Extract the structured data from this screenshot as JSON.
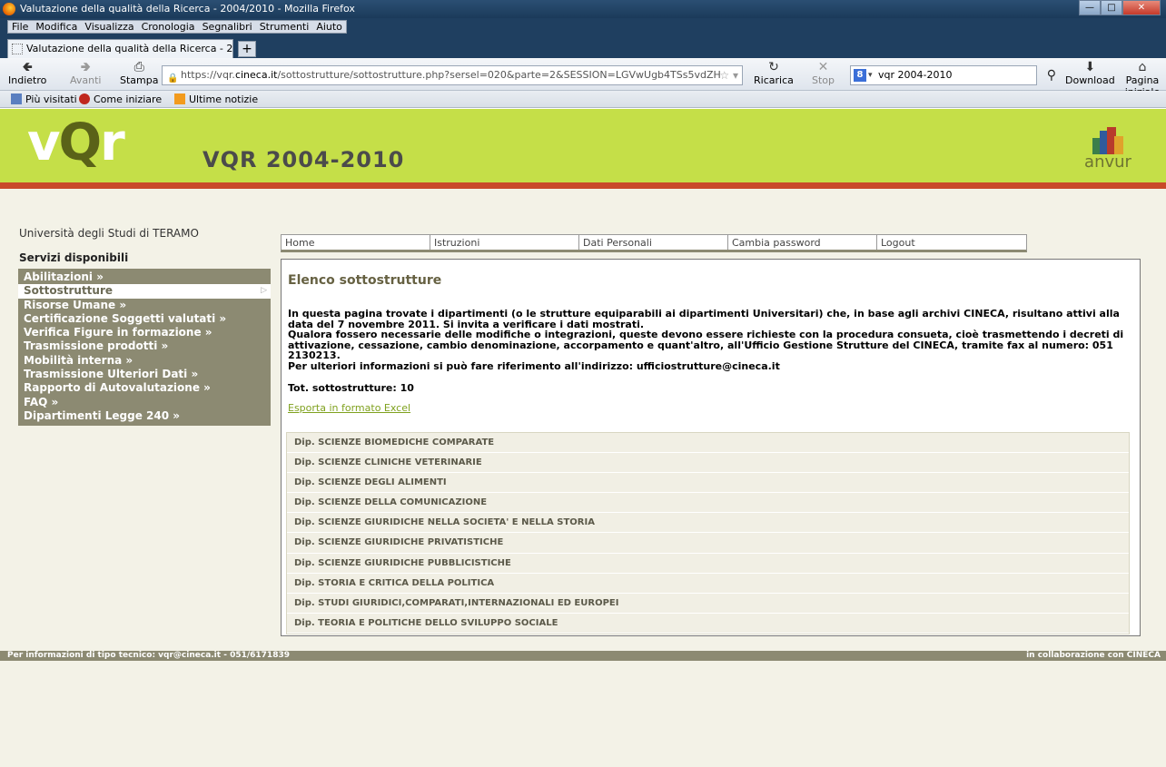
{
  "browser": {
    "window_title": "Valutazione della qualità della Ricerca - 2004/2010 - Mozilla Firefox",
    "menu": [
      "File",
      "Modifica",
      "Visualizza",
      "Cronologia",
      "Segnalibri",
      "Strumenti",
      "Aiuto"
    ],
    "tab_title": "Valutazione della qualità della Ricerca - 2...",
    "new_tab": "+",
    "nav": {
      "back": "Indietro",
      "forward": "Avanti",
      "print": "Stampa",
      "reload": "Ricarica",
      "stop": "Stop",
      "download": "Download",
      "home": "Pagina iniziale"
    },
    "url_prefix": "https://vqr.",
    "url_domain": "cineca.it",
    "url_suffix": "/sottostrutture/sottostrutture.php?sersel=020&parte=2&SESSION=LGVwUgb4TSs5vdZH",
    "search_value": "vqr 2004-2010",
    "bookmarks": [
      "Più visitati",
      "Come iniziare",
      "Ultime notizie"
    ]
  },
  "header": {
    "logo_left": "v",
    "logo_q": "Q",
    "logo_right": "r",
    "title": "VQR 2004-2010",
    "partner_logo": "anvur"
  },
  "sidebar": {
    "university": "Università degli Studi di TERAMO",
    "services_title": "Servizi disponibili",
    "items": [
      {
        "label": "Abilitazioni »"
      },
      {
        "label": "Sottostrutture"
      },
      {
        "label": "Risorse Umane »"
      },
      {
        "label": "Certificazione Soggetti valutati »"
      },
      {
        "label": "Verifica Figure in formazione »"
      },
      {
        "label": "Trasmissione prodotti »"
      },
      {
        "label": "Mobilità interna »"
      },
      {
        "label": "Trasmissione Ulteriori Dati »"
      },
      {
        "label": "Rapporto di Autovalutazione »"
      },
      {
        "label": "FAQ »"
      },
      {
        "label": "Dipartimenti Legge 240 »"
      }
    ],
    "active_index": 1
  },
  "topnav": [
    "Home",
    "Istruzioni",
    "Dati Personali",
    "Cambia password",
    "Logout"
  ],
  "main": {
    "title": "Elenco sottostrutture",
    "paragraph_1": "In questa pagina trovate i dipartimenti (o le strutture equiparabili ai dipartimenti Universitari) che, in base agli archivi CINECA, risultano attivi alla data del 7 novembre 2011. Si invita a verificare i dati mostrati.",
    "paragraph_2": "Qualora fossero necessarie delle modifiche o integrazioni, queste devono essere richieste con la procedura consueta, cioè trasmettendo i decreti di attivazione, cessazione, cambio denominazione, accorpamento e quant'altro, all'Ufficio Gestione Strutture del CINECA, tramite fax al numero: 051 2130213.",
    "paragraph_3": "Per ulteriori informazioni si può fare riferimento all'indirizzo: ufficiostrutture@cineca.it",
    "total": "Tot. sottostrutture: 10",
    "export_link": "Esporta in formato Excel",
    "departments": [
      "Dip. SCIENZE BIOMEDICHE COMPARATE",
      "Dip. SCIENZE CLINICHE VETERINARIE",
      "Dip. SCIENZE DEGLI ALIMENTI",
      "Dip. SCIENZE DELLA COMUNICAZIONE",
      "Dip. SCIENZE GIURIDICHE NELLA SOCIETA' E NELLA STORIA",
      "Dip. SCIENZE GIURIDICHE PRIVATISTICHE",
      "Dip. SCIENZE GIURIDICHE PUBBLICISTICHE",
      "Dip. STORIA E CRITICA DELLA POLITICA",
      "Dip. STUDI GIURIDICI,COMPARATI,INTERNAZIONALI ED EUROPEI",
      "Dip. TEORIA E POLITICHE DELLO SVILUPPO SOCIALE"
    ]
  },
  "footer": {
    "left": "Per informazioni di tipo tecnico: vqr@cineca.it - 051/6171839",
    "right": "in collaborazione con CINECA"
  },
  "colors": {
    "header_green": "#c5df48",
    "accent_red": "#c9492a",
    "menu_olive": "#8c8a72",
    "page_bg": "#f3f2e7",
    "link_green": "#7fa11e"
  }
}
